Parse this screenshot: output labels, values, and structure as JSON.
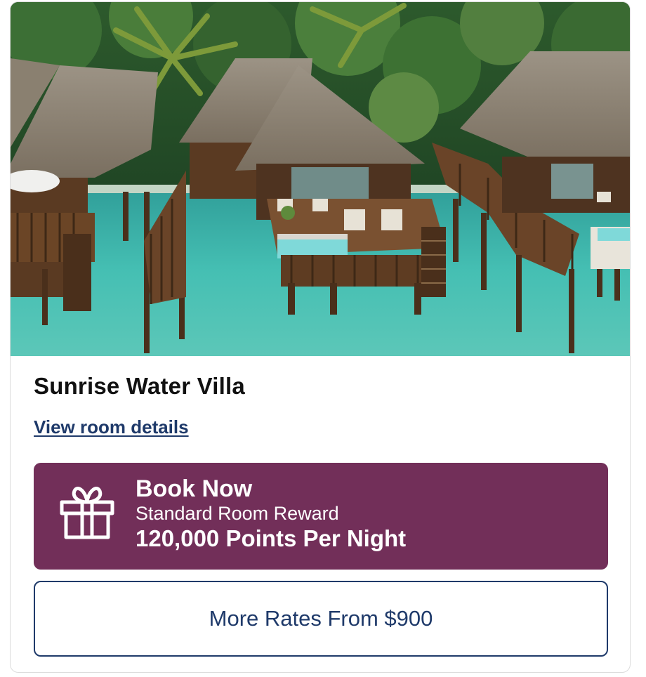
{
  "room": {
    "image_alt": "Overwater villas with thatched roofs over turquoise lagoon",
    "title": "Sunrise Water Villa",
    "details_link": "View room details"
  },
  "book": {
    "title": "Book Now",
    "subtitle": "Standard Room Reward",
    "points": "120,000 Points Per Night",
    "icon": "gift-icon"
  },
  "rates": {
    "label": "More Rates From $900"
  },
  "colors": {
    "book_bg": "#722f59",
    "link": "#1f3a6a",
    "rates_border": "#1f3a6a",
    "water": "#3fb7ad"
  }
}
